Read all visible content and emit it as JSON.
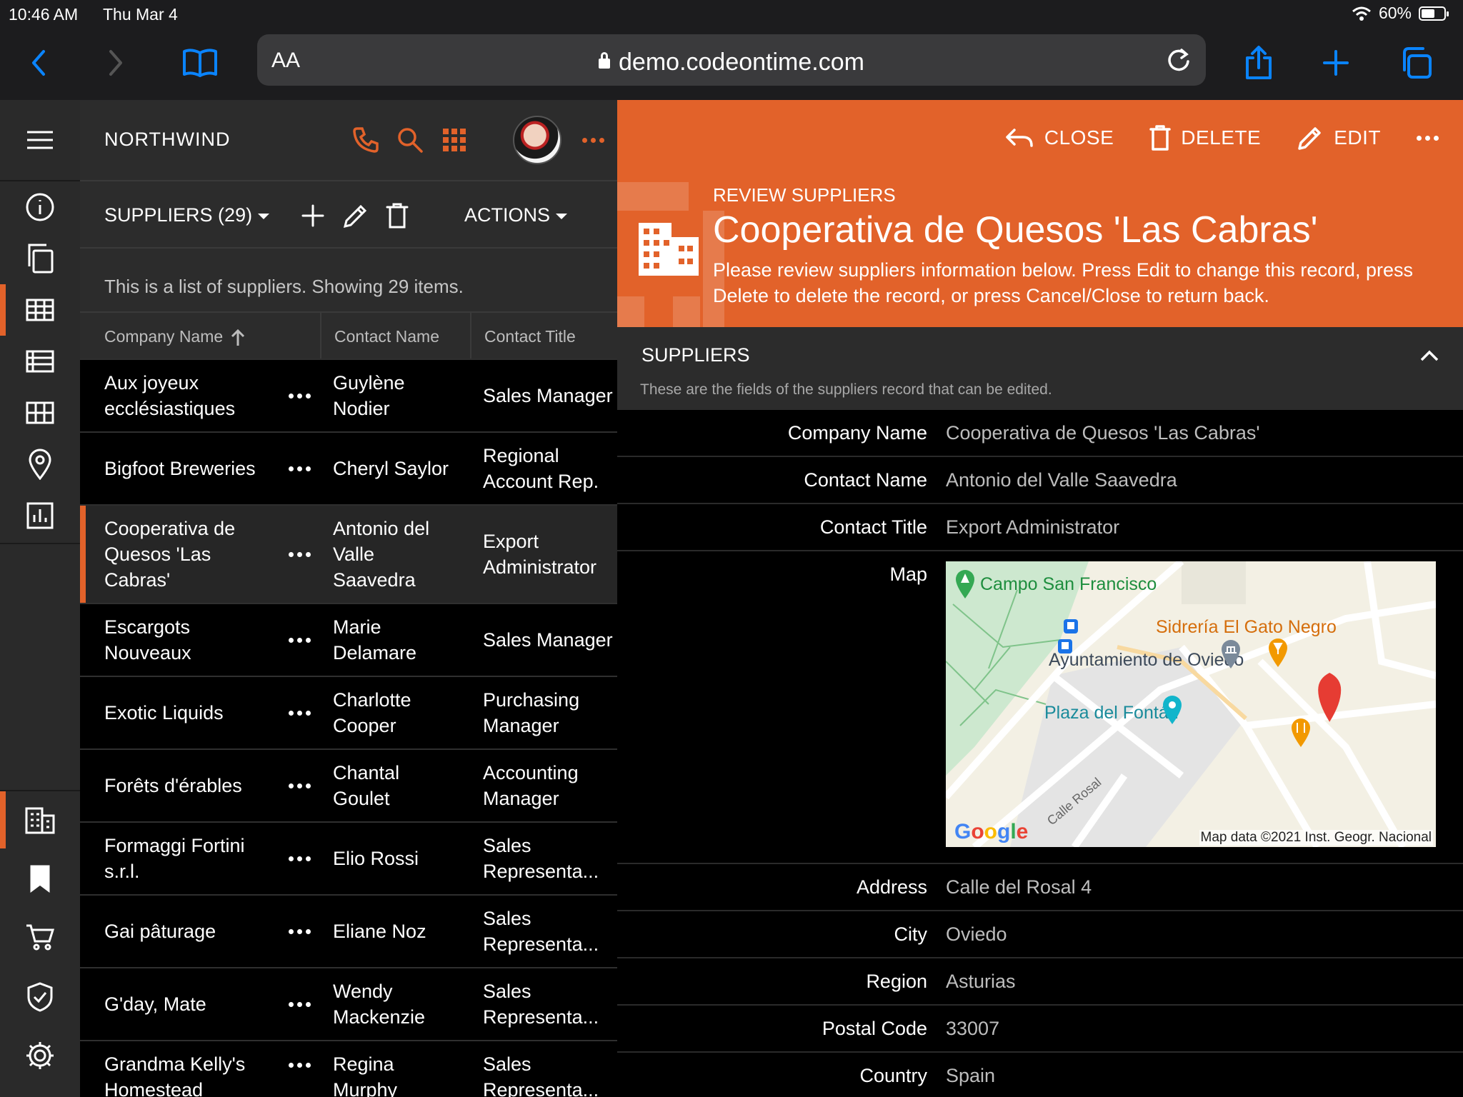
{
  "status": {
    "time": "10:46 AM",
    "date": "Thu Mar 4",
    "battery": "60%",
    "battery_level": 0.6
  },
  "browser": {
    "text_size_label": "AA",
    "url": "demo.codeontime.com"
  },
  "app": {
    "brand": "NORTHWIND"
  },
  "list": {
    "view_label": "SUPPLIERS (29)",
    "actions_label": "ACTIONS",
    "description": "This is a list of suppliers. Showing 29 items.",
    "columns": [
      "Company Name",
      "Contact Name",
      "Contact Title"
    ],
    "rows": [
      {
        "company": "Aux joyeux ecclésiastiques",
        "contact": "Guylène Nodier",
        "title": "Sales Manager"
      },
      {
        "company": "Bigfoot Breweries",
        "contact": "Cheryl Saylor",
        "title": "Regional Account Rep."
      },
      {
        "company": "Cooperativa de Quesos 'Las Cabras'",
        "contact": "Antonio del Valle Saavedra",
        "title": "Export Administrator"
      },
      {
        "company": "Escargots Nouveaux",
        "contact": "Marie Delamare",
        "title": "Sales Manager"
      },
      {
        "company": "Exotic Liquids",
        "contact": "Charlotte Cooper",
        "title": "Purchasing Manager"
      },
      {
        "company": "Forêts d'érables",
        "contact": "Chantal Goulet",
        "title": "Accounting Manager"
      },
      {
        "company": "Formaggi Fortini s.r.l.",
        "contact": "Elio Rossi",
        "title": "Sales Representa..."
      },
      {
        "company": "Gai pâturage",
        "contact": "Eliane Noz",
        "title": "Sales Representa..."
      },
      {
        "company": "G'day, Mate",
        "contact": "Wendy Mackenzie",
        "title": "Sales Representa..."
      },
      {
        "company": "Grandma Kelly's Homestead",
        "contact": "Regina Murphy",
        "title": "Sales Representa..."
      }
    ]
  },
  "detail": {
    "buttons": {
      "close": "CLOSE",
      "delete": "DELETE",
      "edit": "EDIT"
    },
    "kicker": "REVIEW SUPPLIERS",
    "title": "Cooperativa de Quesos 'Las Cabras'",
    "info": "Please review suppliers information below. Press Edit to change this record, press Delete to delete the record, or press Cancel/Close to return back.",
    "category": "SUPPLIERS",
    "category_desc": "These are the fields of the suppliers record that can be edited.",
    "fields": {
      "company": {
        "label": "Company Name",
        "value": "Cooperativa de Quesos 'Las Cabras'"
      },
      "contact": {
        "label": "Contact Name",
        "value": "Antonio del Valle Saavedra"
      },
      "title": {
        "label": "Contact Title",
        "value": "Export Administrator"
      },
      "map": {
        "label": "Map"
      },
      "address": {
        "label": "Address",
        "value": "Calle del Rosal 4"
      },
      "city": {
        "label": "City",
        "value": "Oviedo"
      },
      "region": {
        "label": "Region",
        "value": "Asturias"
      },
      "postal": {
        "label": "Postal Code",
        "value": "33007"
      },
      "country": {
        "label": "Country",
        "value": "Spain"
      }
    },
    "map": {
      "places": [
        "Campo San Francisco",
        "Sidrería El Gato Negro",
        "Ayuntamiento de Oviedo",
        "Plaza del Fontán"
      ],
      "street": "Calle Rosal",
      "logo": "Google",
      "attribution": "Map data ©2021 Inst. Geogr. Nacional"
    }
  },
  "colors": {
    "accent": "#e2622a",
    "ios_blue": "#0a84ff"
  }
}
